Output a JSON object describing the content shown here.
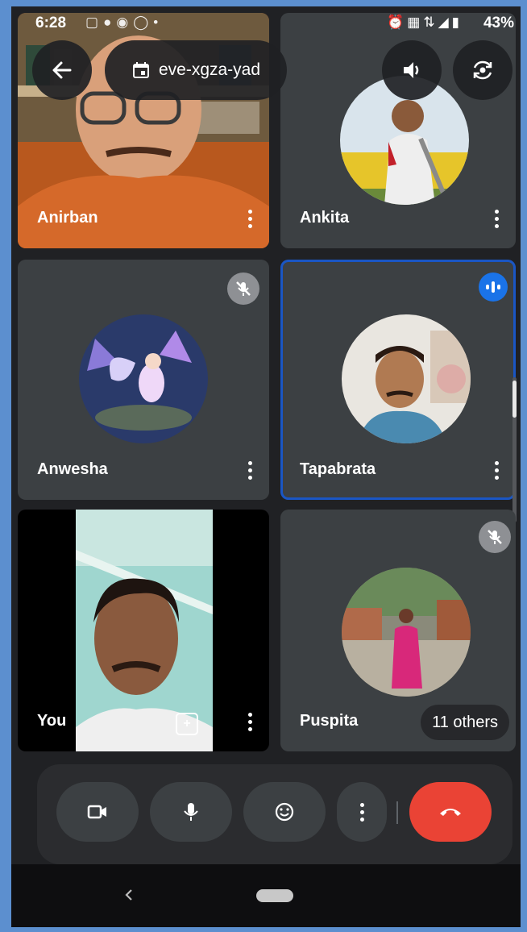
{
  "status_bar": {
    "time": "6:28",
    "left_icons": [
      "message-icon",
      "chat-icon",
      "eye-icon",
      "whatsapp-icon",
      "dot-icon"
    ],
    "right_icons": [
      "alarm-icon",
      "hd-icon",
      "4g-icon",
      "signal-icon",
      "battery-icon"
    ],
    "battery": "43%"
  },
  "top_bar": {
    "meeting_code": "eve-xgza-yad",
    "back_icon": "arrow-back-icon",
    "calendar_icon": "calendar-icon",
    "speaker_icon": "volume-icon",
    "switch_camera_icon": "camera-switch-icon"
  },
  "participants": [
    {
      "name": "Anirban",
      "type": "video"
    },
    {
      "name": "Ankita",
      "type": "avatar"
    },
    {
      "name": "Anwesha",
      "type": "avatar",
      "muted": true
    },
    {
      "name": "Tapabrata",
      "type": "avatar",
      "speaking": true
    },
    {
      "name": "You",
      "type": "self-video"
    },
    {
      "name": "Puspita",
      "type": "avatar",
      "muted": true,
      "others": "11 others"
    }
  ],
  "controls": {
    "camera_icon": "video-camera-icon",
    "mic_icon": "microphone-icon",
    "reaction_icon": "emoji-icon",
    "more_icon": "more-vert-icon",
    "end_call_icon": "call-end-icon",
    "end_call_color": "#ea4335"
  },
  "nav": {
    "back_icon": "nav-back-icon",
    "home_icon": "home-pill-icon"
  },
  "colors": {
    "tile_bg": "#3c4043",
    "app_bg": "#202124",
    "accent": "#1a73e8",
    "active_border": "#1a56c4"
  }
}
